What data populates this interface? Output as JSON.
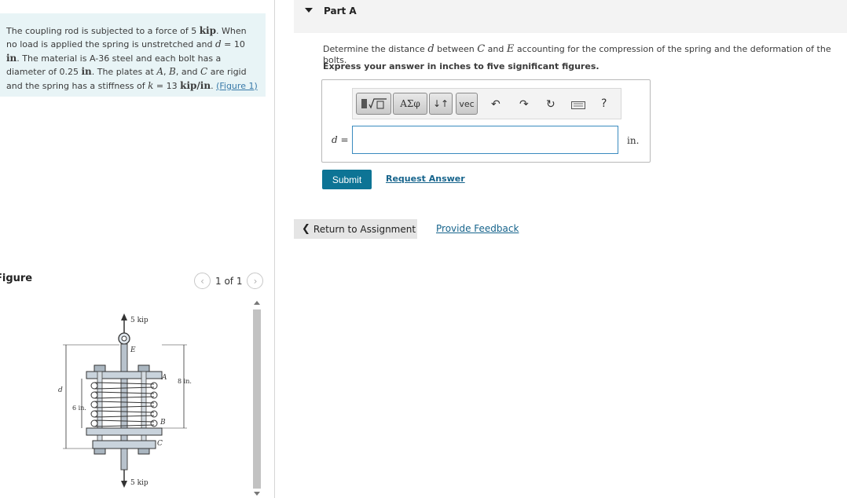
{
  "problem": {
    "t1": "The coupling rod is subjected to a force of 5 ",
    "kip1": "kip",
    "t2": ". When no load is applied the spring is unstretched and ",
    "d_var": "d",
    "t3": " = 10 ",
    "in1": "in",
    "t4": ". The material is A-36 steel and each bolt has a diameter of 0.25 ",
    "in2": "in",
    "t5": ". The plates at ",
    "A": "A",
    "t6": ", ",
    "B": "B",
    "t7": ", and ",
    "C": "C",
    "t8": " are rigid and the spring has a stiffness of ",
    "k": "k",
    "t9": " = 13 ",
    "kipin": "kip/in",
    "t10": ". ",
    "figure_link": "(Figure 1)"
  },
  "figure": {
    "title": "Figure",
    "pager": "1 of 1",
    "prev_icon": "chevron-left-icon",
    "next_icon": "chevron-right-icon",
    "labels": {
      "force_top": "5 kip",
      "force_bottom": "5 kip",
      "E": "E",
      "A": "A",
      "B": "B",
      "C": "C",
      "d": "d",
      "six_in": "6 in.",
      "eight_in": "8 in."
    }
  },
  "part": {
    "label": "Part A",
    "question_pre": "Determine the distance ",
    "question_d": "d",
    "question_mid": " between ",
    "question_C": "C",
    "question_and": " and ",
    "question_E": "E",
    "question_post": " accounting for the compression of the spring and the deformation of the bolts.",
    "instruction": "Express your answer in inches to five significant figures."
  },
  "toolbar": {
    "templates_icon": "templates-icon",
    "greek_label": "ΑΣφ",
    "arrows_label": "↓↑",
    "vec_label": "vec",
    "undo_icon": "undo-icon",
    "redo_icon": "redo-icon",
    "reset_icon": "reset-icon",
    "keyboard_icon": "keyboard-icon",
    "help_label": "?"
  },
  "answer": {
    "var_label": "d",
    "equals": " =",
    "value": "",
    "unit": "in."
  },
  "actions": {
    "submit": "Submit",
    "request_answer": "Request Answer",
    "return": "Return to Assignment",
    "feedback": "Provide Feedback"
  }
}
